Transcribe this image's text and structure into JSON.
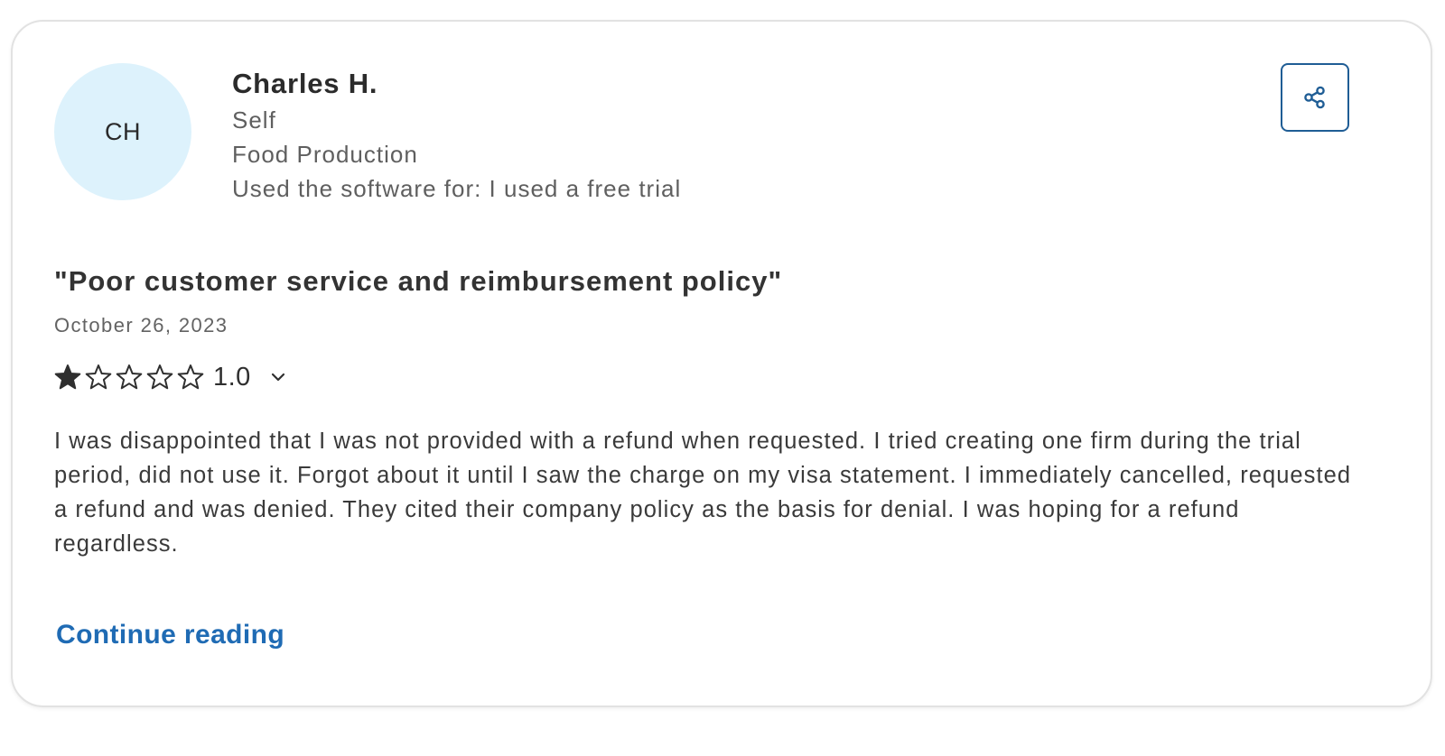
{
  "reviewer": {
    "initials": "CH",
    "name": "Charles H.",
    "role": "Self",
    "industry": "Food Production",
    "usage": "Used the software for: I used a free trial"
  },
  "share": {
    "icon": "share-icon"
  },
  "review": {
    "title": "\"Poor customer service and reimbursement policy\"",
    "date": "October 26, 2023",
    "rating": {
      "value": 1,
      "max": 5,
      "label": "1.0"
    },
    "body": "I was disappointed that I was not provided with a refund when requested. I tried creating one firm during the trial period, did not use it. Forgot about it until I saw the charge on my visa statement. I immediately cancelled, requested a refund and was denied. They cited their company policy as the basis for denial. I was hoping for a refund regardless.",
    "continue_label": "Continue reading"
  },
  "colors": {
    "avatar_bg": "#ddf2fc",
    "accent": "#1f6bb4",
    "share_border": "#1f5d95",
    "star": "#2f2f2f"
  }
}
